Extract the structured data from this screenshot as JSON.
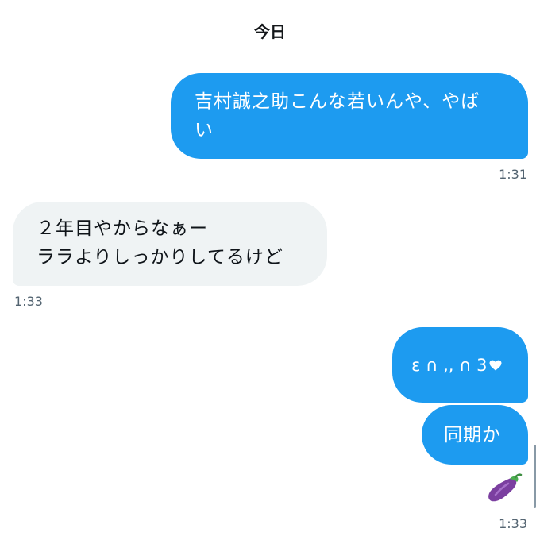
{
  "header": {
    "date_label": "今日"
  },
  "messages": [
    {
      "direction": "sent",
      "lines": [
        "吉村誠之助こんな若いんや、やば",
        "い"
      ],
      "timestamp": "1:31"
    },
    {
      "direction": "received",
      "lines": [
        "２年目やからなぁー",
        "ララよりしっかりしてるけど"
      ],
      "timestamp": "1:33"
    },
    {
      "direction": "sent",
      "text": "ε ∩ ,, ∩ 3",
      "trailing_icon": "white-heart-icon"
    },
    {
      "direction": "sent",
      "text": "同期か"
    },
    {
      "direction": "sent",
      "type": "emoji",
      "emoji_icon": "eggplant-icon",
      "timestamp": "1:33"
    }
  ],
  "colors": {
    "sent_bubble": "#1d9bf0",
    "received_bubble": "#eff3f4",
    "timestamp_text": "#536471"
  }
}
